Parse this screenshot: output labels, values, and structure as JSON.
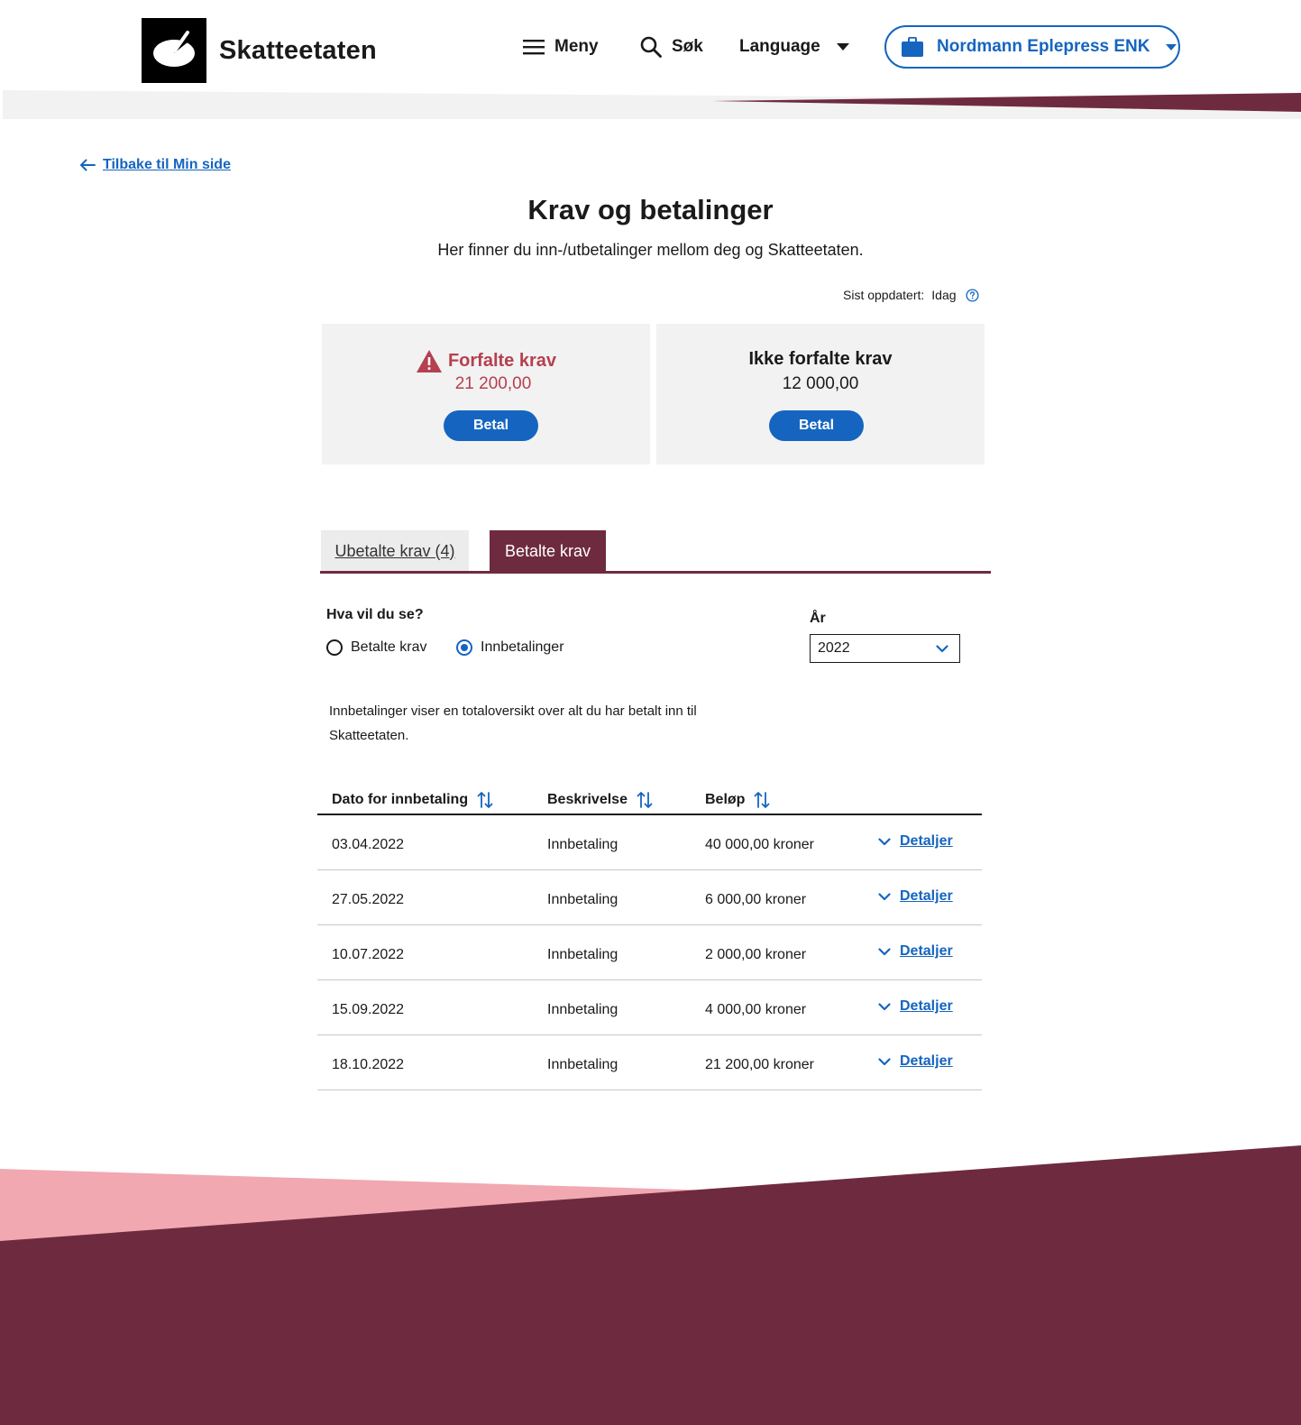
{
  "header": {
    "brand": "Skatteetaten",
    "menu_label": "Meny",
    "search_label": "Søk",
    "language_label": "Language",
    "organization": "Nordmann Eplepress ENK"
  },
  "colors": {
    "primary_blue": "#1565c0",
    "burgundy": "#6e2b3f",
    "pink": "#f1a8b1",
    "error_red": "#b5404f",
    "card_bg": "#f2f2f2"
  },
  "back_link": "Tilbake til Min side",
  "page": {
    "title": "Krav og betalinger",
    "intro": "Her finner du inn-/utbetalinger mellom deg og Skatteetaten.",
    "updated_label": "Sist oppdatert:",
    "updated_value": "Idag"
  },
  "cards": {
    "overdue": {
      "title": "Forfalte krav",
      "amount": "21 200,00",
      "button": "Betal"
    },
    "not_overdue": {
      "title": "Ikke forfalte krav",
      "amount": "12 000,00",
      "button": "Betal"
    }
  },
  "tabs": {
    "unpaid": "Ubetalte krav (4)",
    "paid": "Betalte krav",
    "active": "paid"
  },
  "filters": {
    "question": "Hva vil du se?",
    "option_paid": "Betalte krav",
    "option_payments": "Innbetalinger",
    "selected": "Innbetalinger",
    "year_label": "År",
    "year_value": "2022"
  },
  "info_text": "Innbetalinger viser en totaloversikt over alt du har betalt inn til Skatteetaten.",
  "table": {
    "headers": {
      "date": "Dato for innbetaling",
      "description": "Beskrivelse",
      "amount": "Beløp"
    },
    "details_label": "Detaljer",
    "rows": [
      {
        "date": "03.04.2022",
        "description": "Innbetaling",
        "amount": "40 000,00 kroner"
      },
      {
        "date": "27.05.2022",
        "description": "Innbetaling",
        "amount": "6 000,00 kroner"
      },
      {
        "date": "10.07.2022",
        "description": "Innbetaling",
        "amount": "2 000,00 kroner"
      },
      {
        "date": "15.09.2022",
        "description": "Innbetaling",
        "amount": "4 000,00 kroner"
      },
      {
        "date": "18.10.2022",
        "description": "Innbetaling",
        "amount": "21 200,00 kroner"
      }
    ]
  }
}
